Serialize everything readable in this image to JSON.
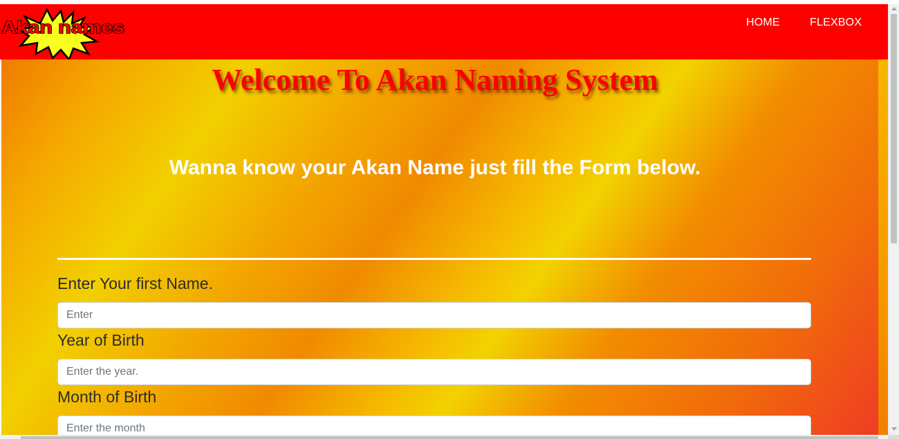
{
  "logo": {
    "text": "Akan names",
    "colors": {
      "burst": "#f8ff1f",
      "outline": "#000000",
      "text": "#ff0000"
    }
  },
  "nav": {
    "home_label": "HOME",
    "flexbox_label": "FLEXBOX"
  },
  "hero": {
    "title": "Welcome To Akan Naming System",
    "tagline": "Wanna know your Akan Name just fill the Form below."
  },
  "form": {
    "first_name": {
      "label": "Enter Your first Name.",
      "placeholder": "Enter",
      "value": ""
    },
    "year": {
      "label": "Year of Birth",
      "placeholder": "Enter the year.",
      "value": ""
    },
    "month": {
      "label": "Month of Birth",
      "placeholder": "Enter the month",
      "value": ""
    }
  },
  "colors": {
    "navbar": "#ff0000",
    "title": "#ff0000",
    "tagline": "#ffffff",
    "gradient_yellow": "#f2d000",
    "gradient_orange": "#f08a00",
    "gradient_red": "#ef3a25"
  }
}
